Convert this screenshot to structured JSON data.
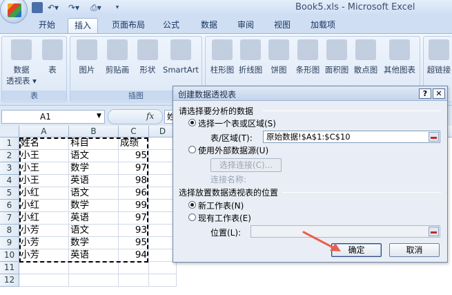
{
  "window": {
    "title": "Book5.xls - Microsoft Excel"
  },
  "quick_access": {
    "save_icon": "save-icon",
    "undo_glyph": "↶▾",
    "redo_glyph": "↷▾",
    "print_glyph": "⎙▾",
    "more_glyph": "▾"
  },
  "tabs": [
    {
      "label": "开始"
    },
    {
      "label": "插入"
    },
    {
      "label": "页面布局"
    },
    {
      "label": "公式"
    },
    {
      "label": "数据"
    },
    {
      "label": "审阅"
    },
    {
      "label": "视图"
    },
    {
      "label": "加载项"
    }
  ],
  "active_tab": "插入",
  "ribbon": {
    "groups": [
      {
        "label": "表"
      },
      {
        "label": "插图"
      },
      {
        "label": ""
      }
    ],
    "buttons": {
      "pivot_line1": "数据",
      "pivot_line2": "透视表 ▾",
      "table": "表",
      "picture": "图片",
      "clipart": "剪贴画",
      "shapes": "形状",
      "smartart": "SmartArt",
      "column_chart": "柱形图",
      "line_chart": "折线图",
      "pie_chart": "饼图",
      "bar_chart": "条形图",
      "area_chart": "面积图",
      "scatter_chart": "散点图",
      "other_charts": "其他图表",
      "hyperlink": "超链接"
    }
  },
  "formula_bar": {
    "name_box": "A1",
    "fx": "fx",
    "content": "姓"
  },
  "sheet": {
    "columns": [
      "A",
      "B",
      "C",
      "D"
    ],
    "rows": [
      "1",
      "2",
      "3",
      "4",
      "5",
      "6",
      "7",
      "8",
      "9",
      "10",
      "11",
      "12"
    ],
    "data": [
      [
        "姓名",
        "科目",
        "成绩"
      ],
      [
        "小王",
        "语文",
        "95"
      ],
      [
        "小王",
        "数学",
        "97"
      ],
      [
        "小王",
        "英语",
        "98"
      ],
      [
        "小红",
        "语文",
        "96"
      ],
      [
        "小红",
        "数学",
        "99"
      ],
      [
        "小红",
        "英语",
        "97"
      ],
      [
        "小芳",
        "语文",
        "93"
      ],
      [
        "小芳",
        "数学",
        "95"
      ],
      [
        "小芳",
        "英语",
        "94"
      ]
    ]
  },
  "dialog": {
    "title": "创建数据透视表",
    "help": "?",
    "close": "✕",
    "section1": "请选择要分析的数据",
    "opt_table": "选择一个表或区域(S)",
    "range_label": "表/区域(T):",
    "range_value": "原始数据!$A$1:$C$10",
    "opt_external": "使用外部数据源(U)",
    "choose_conn": "选择连接(C)...",
    "conn_name": "连接名称:",
    "section2": "选择放置数据透视表的位置",
    "opt_new_sheet": "新工作表(N)",
    "opt_existing": "现有工作表(E)",
    "location_label": "位置(L):",
    "location_value": "",
    "ok": "确定",
    "cancel": "取消"
  },
  "colors": {
    "accent_arrow": "#e8604c",
    "title_text": "#3b4f6e"
  }
}
